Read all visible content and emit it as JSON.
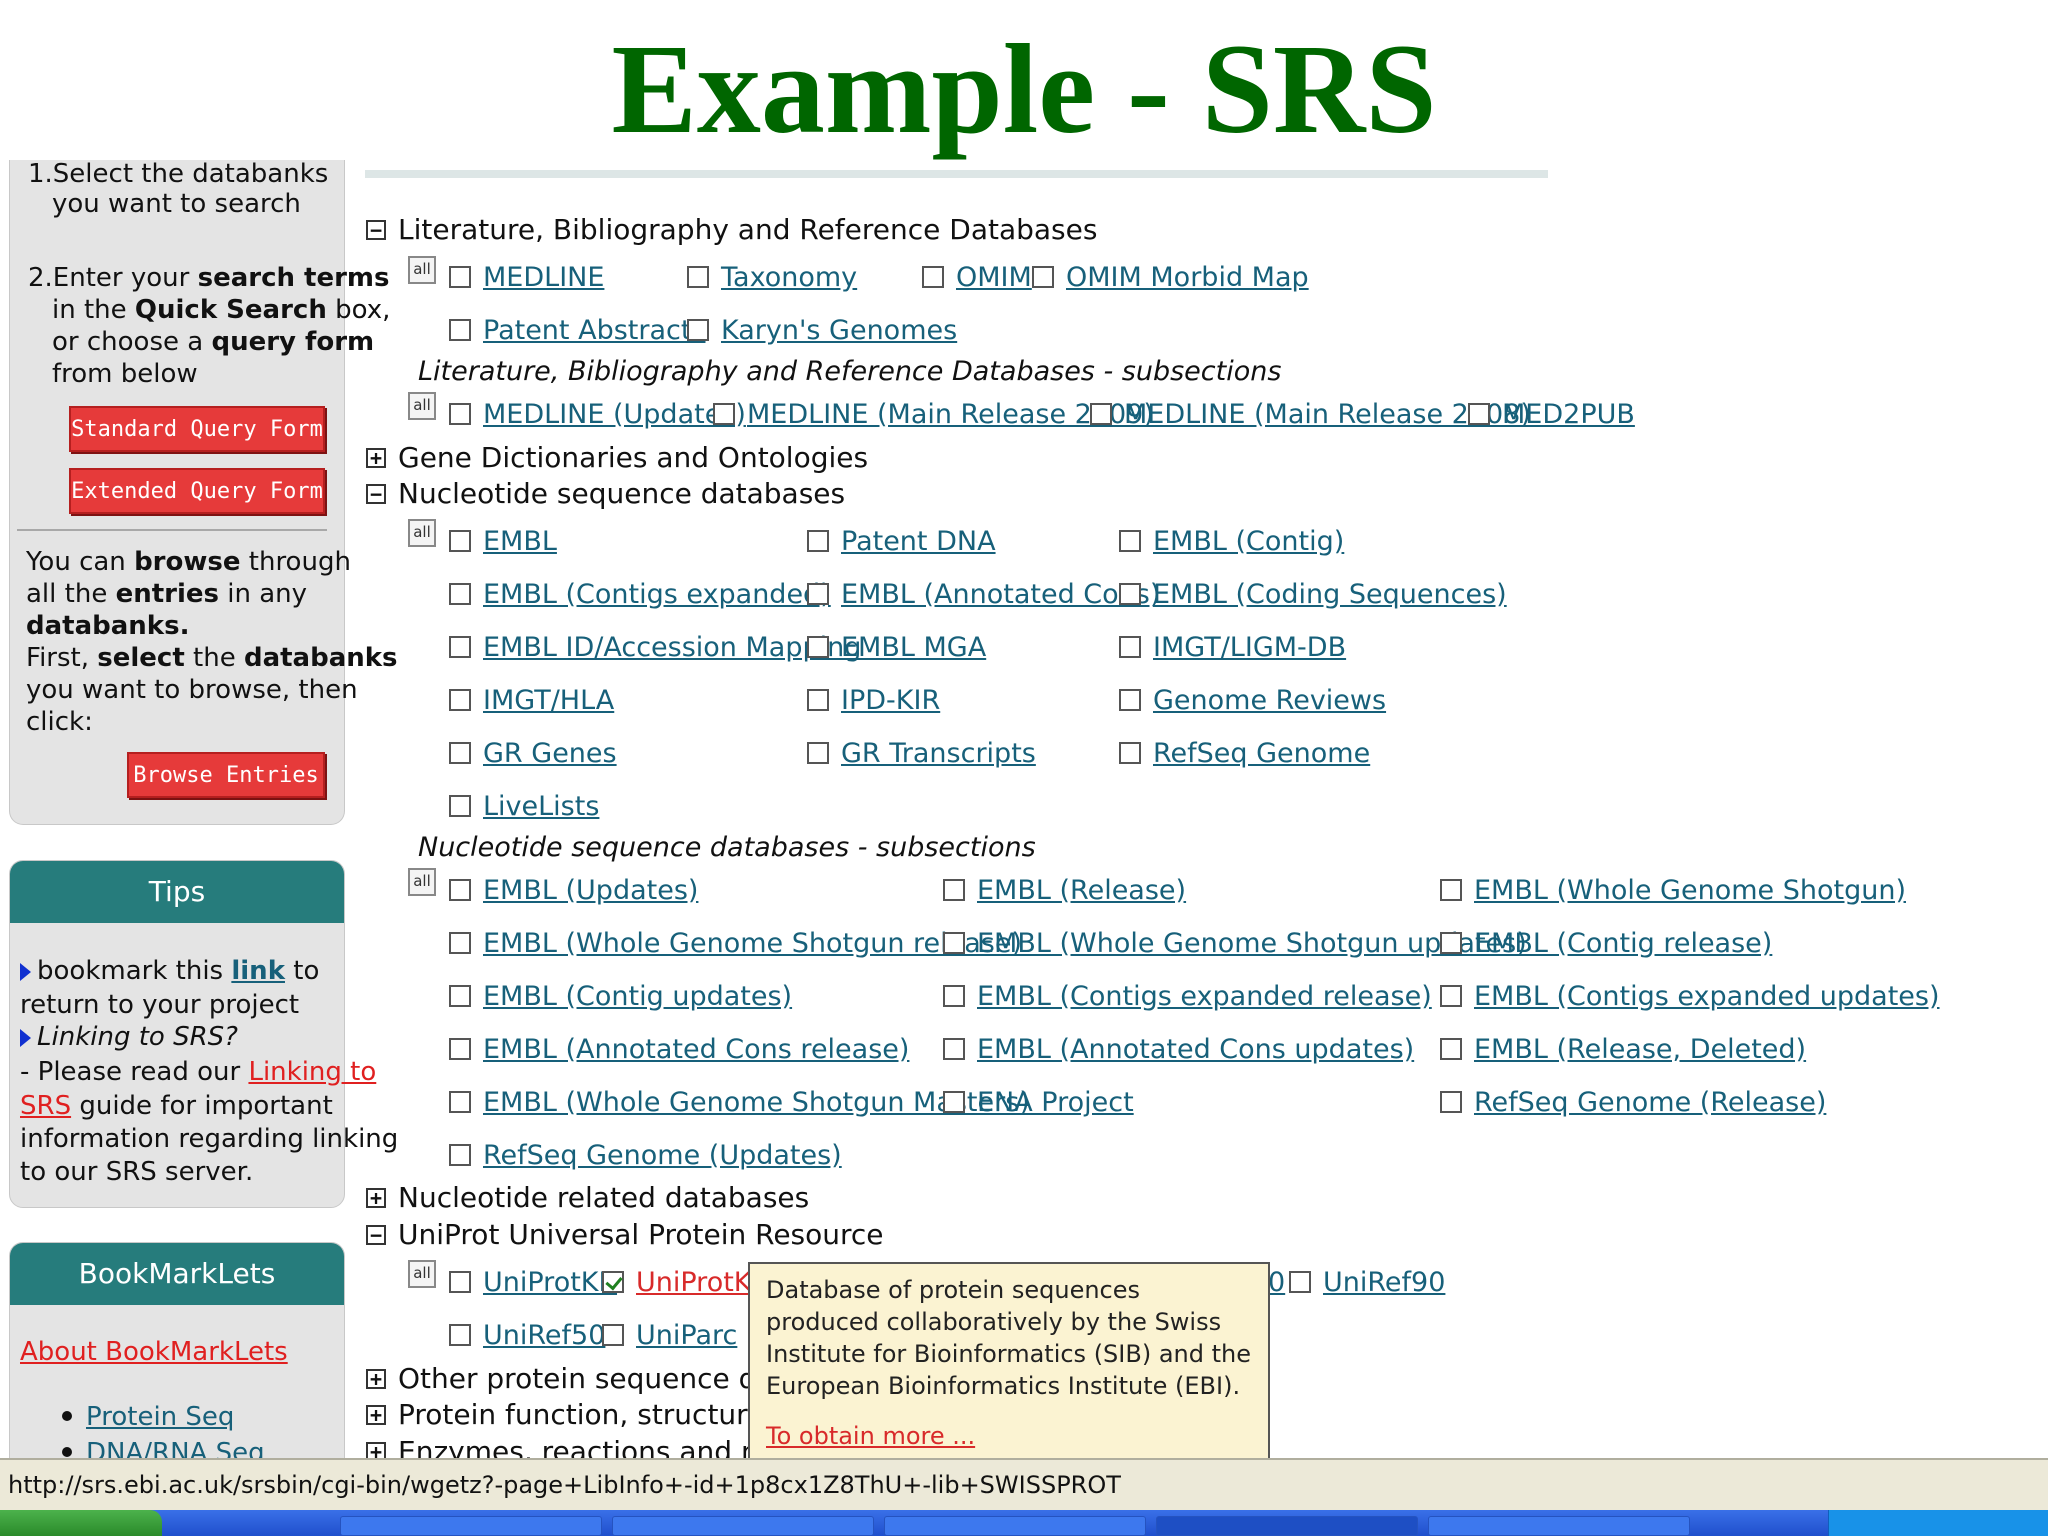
{
  "slide_title": "Example - SRS",
  "sidebar": {
    "step1_line1": "1.Select the databanks",
    "step1_line2": "you want to search",
    "step2_l1a": "2.Enter your ",
    "step2_l1b": "search terms",
    "step2_l2a": "in the ",
    "step2_l2b": "Quick Search",
    "step2_l2c": " box,",
    "step2_l3a": "or choose a ",
    "step2_l3b": "query form",
    "step2_l4": "from below",
    "standard_query_btn": "Standard Query Form",
    "extended_query_btn": "Extended Query Form",
    "browse_l1a": "You can ",
    "browse_l1b": "browse",
    "browse_l1c": " through",
    "browse_l2a": "all the ",
    "browse_l2b": "entries",
    "browse_l2c": " in any",
    "browse_l3": "databanks.",
    "browse_l4a": "First, ",
    "browse_l4b": "select",
    "browse_l4c": " the ",
    "browse_l4d": "databanks",
    "browse_l5": "you want to browse, then",
    "browse_l6": "click:",
    "browse_entries_btn": "Browse Entries",
    "tips_title": "Tips",
    "tips_l1a": "bookmark this ",
    "tips_link": "link",
    "tips_l1b": " to",
    "tips_l2": "return to your project",
    "tips_l3": "Linking to SRS?",
    "tips_l4a": "- Please read our ",
    "tips_link2a": "Linking to",
    "tips_link2b": "SRS",
    "tips_l5": " guide for important",
    "tips_l6": "information regarding linking",
    "tips_l7": "to our SRS server.",
    "bookmarklets_title": "BookMarkLets",
    "about_bookmarklets": "About BookMarkLets",
    "bm_items": [
      "Protein Seq",
      "DNA/RNA Seq"
    ]
  },
  "sections": {
    "lit": "Literature, Bibliography and Reference Databases",
    "lit_sub": "Literature, Bibliography and Reference Databases - subsections",
    "gene": "Gene Dictionaries and Ontologies",
    "nuc": "Nucleotide sequence databases",
    "nuc_sub": "Nucleotide sequence databases - subsections",
    "nucrel": "Nucleotide related databases",
    "uniprot": "UniProt Universal Protein Resource",
    "other": "Other protein sequence data",
    "func": "Protein function, structure a",
    "enz": "Enzymes, reactions and met"
  },
  "all_label": "all",
  "lit_dbs": [
    "MEDLINE",
    "Taxonomy",
    "OMIM",
    "OMIM Morbid Map",
    "Patent Abstracts",
    "Karyn's Genomes"
  ],
  "lit_sub_dbs": [
    "MEDLINE (Updates)",
    "MEDLINE (Main Release 2009)",
    "MEDLINE (Main Release 2008)",
    "MED2PUB"
  ],
  "nuc_dbs": [
    "EMBL",
    "Patent DNA",
    "EMBL (Contig)",
    "EMBL (Contigs expanded)",
    "EMBL (Annotated Cons)",
    "EMBL (Coding Sequences)",
    "EMBL ID/Accession Mapping",
    "EMBL MGA",
    "IMGT/LIGM-DB",
    "IMGT/HLA",
    "IPD-KIR",
    "Genome Reviews",
    "GR Genes",
    "GR Transcripts",
    "RefSeq Genome",
    "LiveLists"
  ],
  "nuc_sub_dbs": [
    "EMBL (Updates)",
    "EMBL (Release)",
    "EMBL (Whole Genome Shotgun)",
    "EMBL (Whole Genome Shotgun release)",
    "EMBL (Whole Genome Shotgun updates)",
    "EMBL (Contig release)",
    "EMBL (Contig updates)",
    "EMBL (Contigs expanded release)",
    "EMBL (Contigs expanded updates)",
    "EMBL (Annotated Cons release)",
    "EMBL (Annotated Cons updates)",
    "EMBL (Release, Deleted)",
    "EMBL (Whole Genome Shotgun Masters)",
    "ENA Project",
    "RefSeq Genome (Release)",
    "RefSeq Genome (Updates)"
  ],
  "uniprot_dbs": [
    "UniProtKB",
    "UniProtKB/",
    "0",
    "UniRef90",
    "UniRef50",
    "UniParc"
  ],
  "tooltip": {
    "text": "Database of protein sequences produced collaboratively by the Swiss Institute for Bioinformatics (SIB) and the European Bioinformatics Institute (EBI).",
    "more": "To obtain more ..."
  },
  "status_url": "http://srs.ebi.ac.uk/srsbin/cgi-bin/wgetz?-page+LibInfo+-id+1p8cx1Z8ThU+-lib+SWISSPROT",
  "colors": {
    "title": "#006600",
    "panel_head": "#267c7c",
    "button": "#e63a3a",
    "link": "#17607a"
  }
}
